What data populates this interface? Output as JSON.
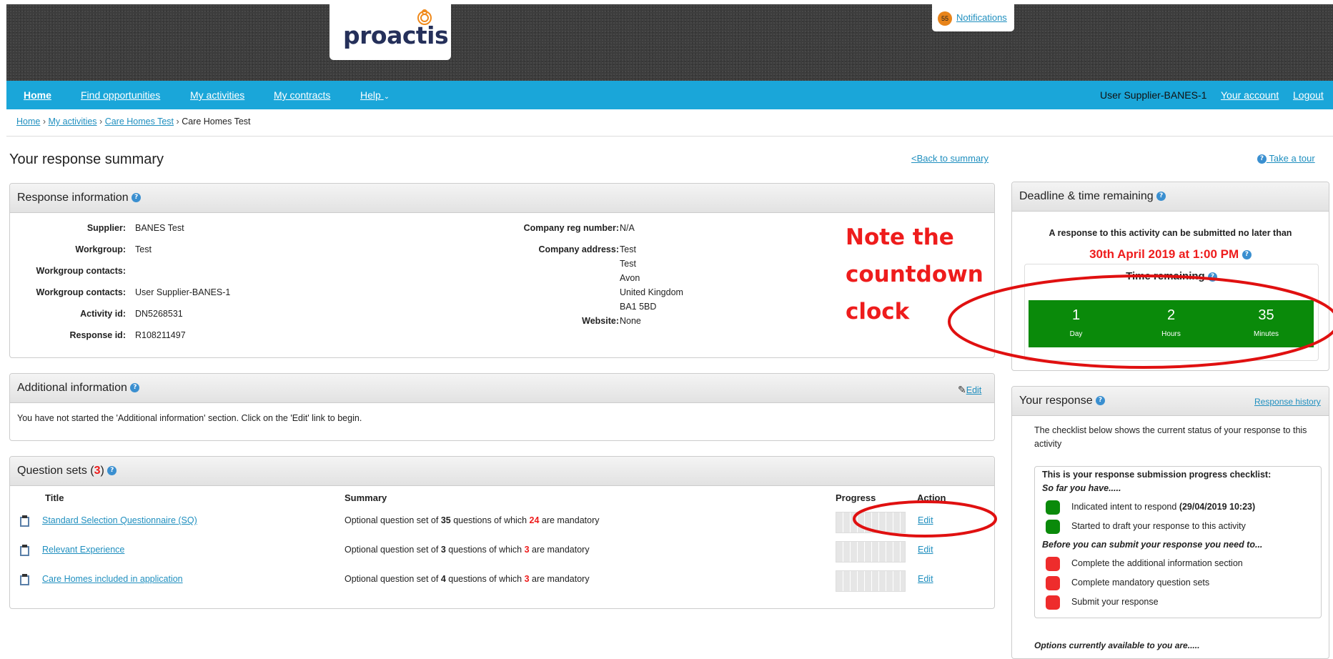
{
  "logo": {
    "text": "proactis"
  },
  "notifications": {
    "count": "55",
    "label": "Notifications"
  },
  "nav": {
    "items": [
      "Home",
      "Find opportunities",
      "My activities",
      "My contracts",
      "Help"
    ],
    "user": "User Supplier-BANES-1",
    "account": "Your account",
    "logout": "Logout"
  },
  "breadcrumb": {
    "items": [
      "Home",
      "My activities",
      "Care Homes Test"
    ],
    "current": "Care Homes Test"
  },
  "page": {
    "title": "Your response summary",
    "back": "<Back to summary",
    "tour": " Take a tour"
  },
  "response_info": {
    "title": "Response information",
    "left": [
      {
        "label": "Supplier:",
        "value": "BANES Test"
      },
      {
        "label": "Workgroup:",
        "value": "Test"
      },
      {
        "label": "Workgroup contacts:",
        "value": ""
      },
      {
        "label": "Workgroup contacts:",
        "value": "User Supplier-BANES-1"
      },
      {
        "label": "Activity id:",
        "value": "DN5268531"
      },
      {
        "label": "Response id:",
        "value": "R108211497"
      }
    ],
    "reg_label": "Company reg number:",
    "reg_value": "N/A",
    "address_label": "Company address:",
    "address": [
      "Test",
      "Test",
      "Avon",
      "United Kingdom",
      "BA1 5BD"
    ],
    "website_label": "Website:",
    "website_value": "None"
  },
  "annotation": {
    "lines": [
      "Note the",
      "countdown",
      "clock"
    ]
  },
  "additional_info": {
    "title": "Additional information",
    "edit": "Edit",
    "text": "You have not started the 'Additional information' section. Click on the 'Edit' link to begin."
  },
  "question_sets": {
    "title": "Question sets",
    "count": "3",
    "columns": [
      "Title",
      "Summary",
      "Progress",
      "Action"
    ],
    "rows": [
      {
        "title": "Standard Selection Questionnaire (SQ)",
        "s1": "Optional question set of ",
        "total": "35",
        "s2": " questions of which ",
        "mandatory": "24",
        "s3": " are mandatory",
        "action": "Edit",
        "progress": 0
      },
      {
        "title": "Relevant Experience",
        "s1": "Optional question set of ",
        "total": "3",
        "s2": " questions of which ",
        "mandatory": "3",
        "s3": " are mandatory",
        "action": "Edit",
        "progress": 0
      },
      {
        "title": "Care Homes included in application",
        "s1": "Optional question set of ",
        "total": "4",
        "s2": " questions of which ",
        "mandatory": "3",
        "s3": " are mandatory",
        "action": "Edit",
        "progress": 0
      }
    ]
  },
  "deadline": {
    "title": "Deadline & time remaining",
    "text": "A response to this activity can be submitted no later than",
    "date": "30th April 2019 at 1:00 PM",
    "remaining_title": "Time remaining",
    "units": [
      {
        "num": "1",
        "label": "Day"
      },
      {
        "num": "2",
        "label": "Hours"
      },
      {
        "num": "35",
        "label": "Minutes"
      }
    ]
  },
  "your_response": {
    "title": "Your response",
    "history": "Response history",
    "intro": "The checklist below shows the current status of your response to this activity",
    "checklist_title": "This is your response submission progress checklist:",
    "so_far": "So far you have.....",
    "done": [
      "Indicated intent to respond ",
      "Started to draft your response to this activity"
    ],
    "done_date": "(29/04/2019 10:23)",
    "before": "Before you can submit your response you need to...",
    "todo": [
      "Complete the additional information section",
      "Complete mandatory question sets",
      "Submit your response"
    ],
    "options": "Options currently available to you are....."
  },
  "colors": {
    "nav": "#1aa6d9",
    "accent_red": "#ee1c1c",
    "clock_green": "#0a8a0a",
    "link": "#1f8fbf"
  }
}
